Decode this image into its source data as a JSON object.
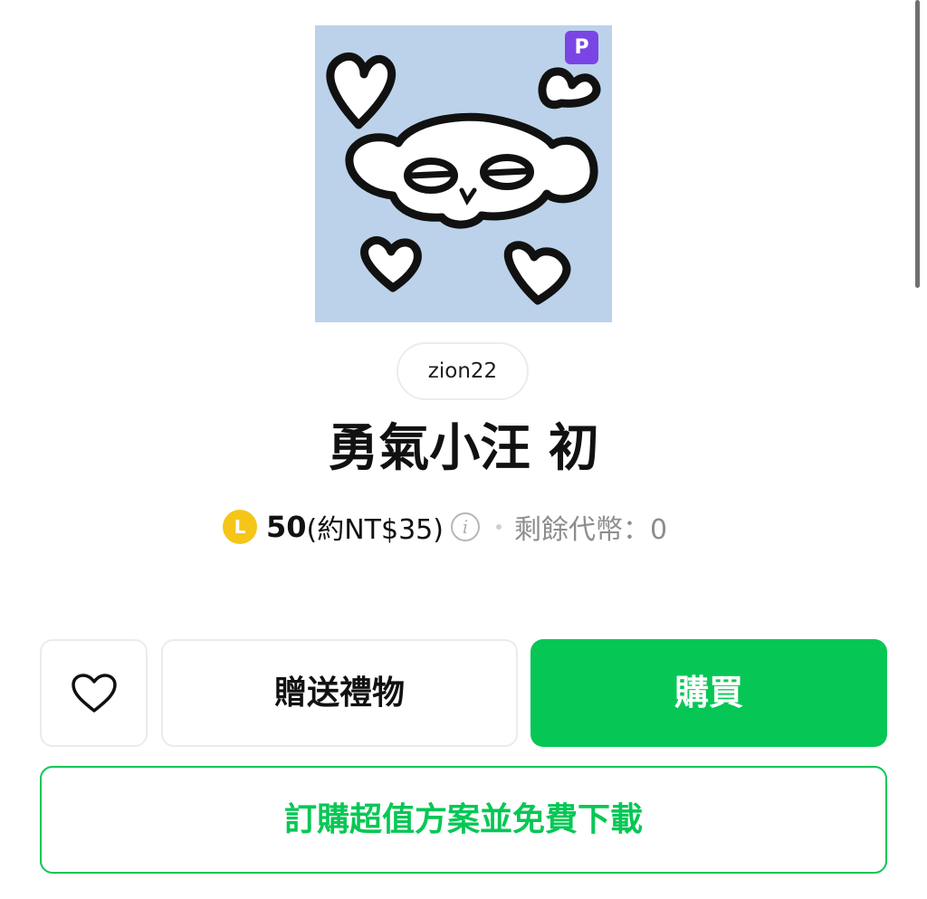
{
  "sticker": {
    "premium_badge": "P",
    "background_color": "#bcd2ea"
  },
  "author": {
    "name": "zion22"
  },
  "title": "勇氣小汪 初",
  "price": {
    "coin_letter": "L",
    "amount": "50",
    "approx": "(約NT$35)",
    "info_icon": "i",
    "balance": "剩餘代幣：0"
  },
  "actions": {
    "favorite_icon": "heart-outline-icon",
    "gift_label": "贈送禮物",
    "buy_label": "購買",
    "subscribe_label": "訂購超值方案並免費下載"
  },
  "colors": {
    "accent": "#06c755",
    "premium": "#7b45e6",
    "coin": "#f5c518"
  }
}
